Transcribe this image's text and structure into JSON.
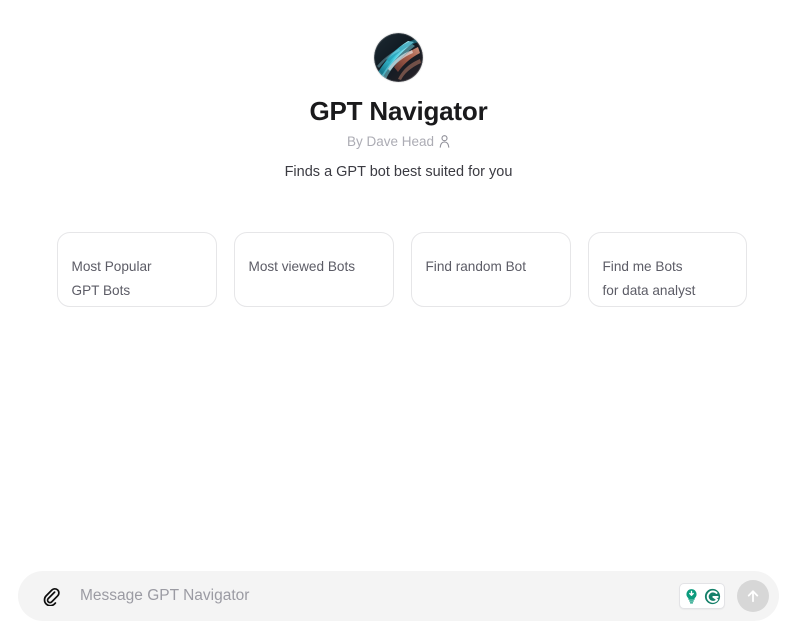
{
  "bot": {
    "title": "GPT Navigator",
    "byline_prefix": "By Dave Head",
    "byline_icon": "person-icon",
    "description": "Finds a GPT bot best suited for you",
    "avatar_icon": "abstract-swoosh-avatar"
  },
  "starters": [
    {
      "label": "Most Popular\nGPT Bots"
    },
    {
      "label": "Most viewed Bots"
    },
    {
      "label": "Find random Bot"
    },
    {
      "label": "Find me Bots\nfor data analyst"
    }
  ],
  "composer": {
    "attach_icon": "paperclip-icon",
    "placeholder": "Message GPT Navigator",
    "value": "",
    "send_icon": "arrow-up-icon",
    "extensions": [
      {
        "name": "lightbulb-download-icon",
        "color": "#0b9b7d"
      },
      {
        "name": "grammarly-g-icon",
        "color": "#15806a"
      }
    ]
  },
  "colors": {
    "page_bg": "#ffffff",
    "composer_bg": "#f4f4f4",
    "card_border": "#e6e6e8",
    "card_text": "#5c5c66",
    "title_text": "#1a1a1c",
    "byline_text": "#acacb4",
    "send_bg": "#d7d7d7",
    "ext_green": "#0b9b7d",
    "ext_dark_green": "#15806a"
  }
}
